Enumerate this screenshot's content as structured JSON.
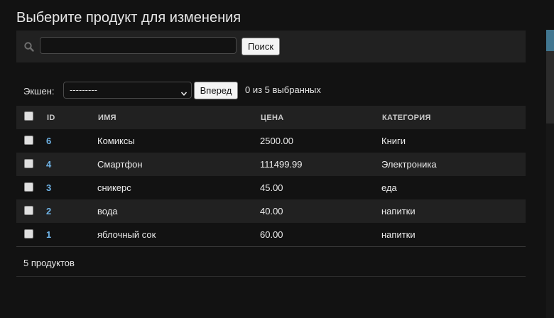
{
  "page": {
    "title": "Выберите продукт для изменения"
  },
  "search": {
    "placeholder": "",
    "value": "",
    "button_label": "Поиск"
  },
  "actions": {
    "label": "Экшен:",
    "select_value": "---------",
    "go_label": "Вперед",
    "selected_counter": "0 из 5 выбранных"
  },
  "table": {
    "headers": {
      "id": "ID",
      "name": "ИМЯ",
      "price": "ЦЕНА",
      "category": "КАТЕГОРИЯ"
    },
    "rows": [
      {
        "id": "6",
        "name": "Комиксы",
        "price": "2500.00",
        "category": "Книги"
      },
      {
        "id": "4",
        "name": "Смартфон",
        "price": "111499.99",
        "category": "Электроника"
      },
      {
        "id": "3",
        "name": "сникерс",
        "price": "45.00",
        "category": "еда"
      },
      {
        "id": "2",
        "name": "вода",
        "price": "40.00",
        "category": "напитки"
      },
      {
        "id": "1",
        "name": "яблочный сок",
        "price": "60.00",
        "category": "напитки"
      }
    ]
  },
  "paginator": {
    "count_text": "5 продуктов"
  },
  "icons": {
    "search": "search-icon",
    "select_arrow": "chevron-down-icon"
  },
  "colors": {
    "background": "#121212",
    "bar": "#212121",
    "link": "#6fb3e6",
    "accent": "#417690"
  }
}
